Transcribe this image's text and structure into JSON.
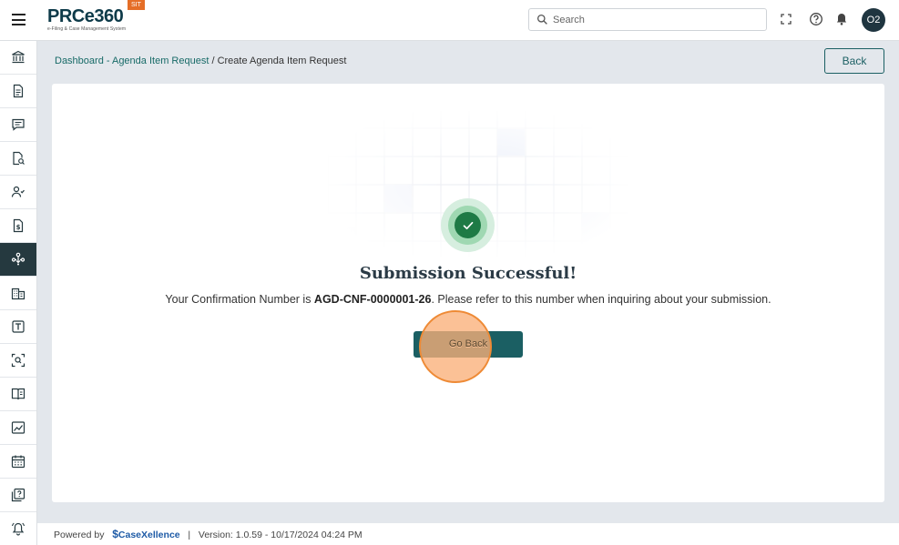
{
  "header": {
    "logo_text": "PRCe360",
    "logo_subtitle": "e-Filing & Case Management System",
    "env_badge": "SIT",
    "search_placeholder": "Search",
    "user_initials": "O2"
  },
  "sidebar": {
    "items": [
      {
        "icon": "bank-icon",
        "active": false
      },
      {
        "icon": "document-icon",
        "active": false
      },
      {
        "icon": "chat-icon",
        "active": false
      },
      {
        "icon": "document-search-icon",
        "active": false
      },
      {
        "icon": "users-icon",
        "active": false
      },
      {
        "icon": "dollar-file-icon",
        "active": false
      },
      {
        "icon": "hierarchy-icon",
        "active": true
      },
      {
        "icon": "building-icon",
        "active": false
      },
      {
        "icon": "text-box-icon",
        "active": false
      },
      {
        "icon": "scan-search-icon",
        "active": false
      },
      {
        "icon": "book-icon",
        "active": false
      },
      {
        "icon": "image-chart-icon",
        "active": false
      },
      {
        "icon": "calendar-icon",
        "active": false
      },
      {
        "icon": "help-copy-icon",
        "active": false
      },
      {
        "icon": "bell-alert-icon",
        "active": false
      }
    ]
  },
  "breadcrumb": {
    "link": "Dashboard - Agenda Item Request",
    "separator": " / ",
    "current": "Create Agenda Item Request"
  },
  "back_button": "Back",
  "success": {
    "title": "Submission Successful!",
    "prefix": "Your Confirmation Number is ",
    "confirmation_number": "AGD-CNF-0000001-26",
    "suffix": ". Please refer to this number when inquiring about your submission.",
    "go_back_label": "Go Back"
  },
  "footer": {
    "powered_by": "Powered by",
    "brand": "CaseXellence",
    "separator": "|",
    "version": "Version: 1.0.59 - 10/17/2024 04:24 PM"
  },
  "colors": {
    "primary": "#1b5f63",
    "sidebar_active": "#25393f",
    "success": "#1e7a45",
    "badge": "#e56e27",
    "click_marker": "#ee8a35"
  }
}
